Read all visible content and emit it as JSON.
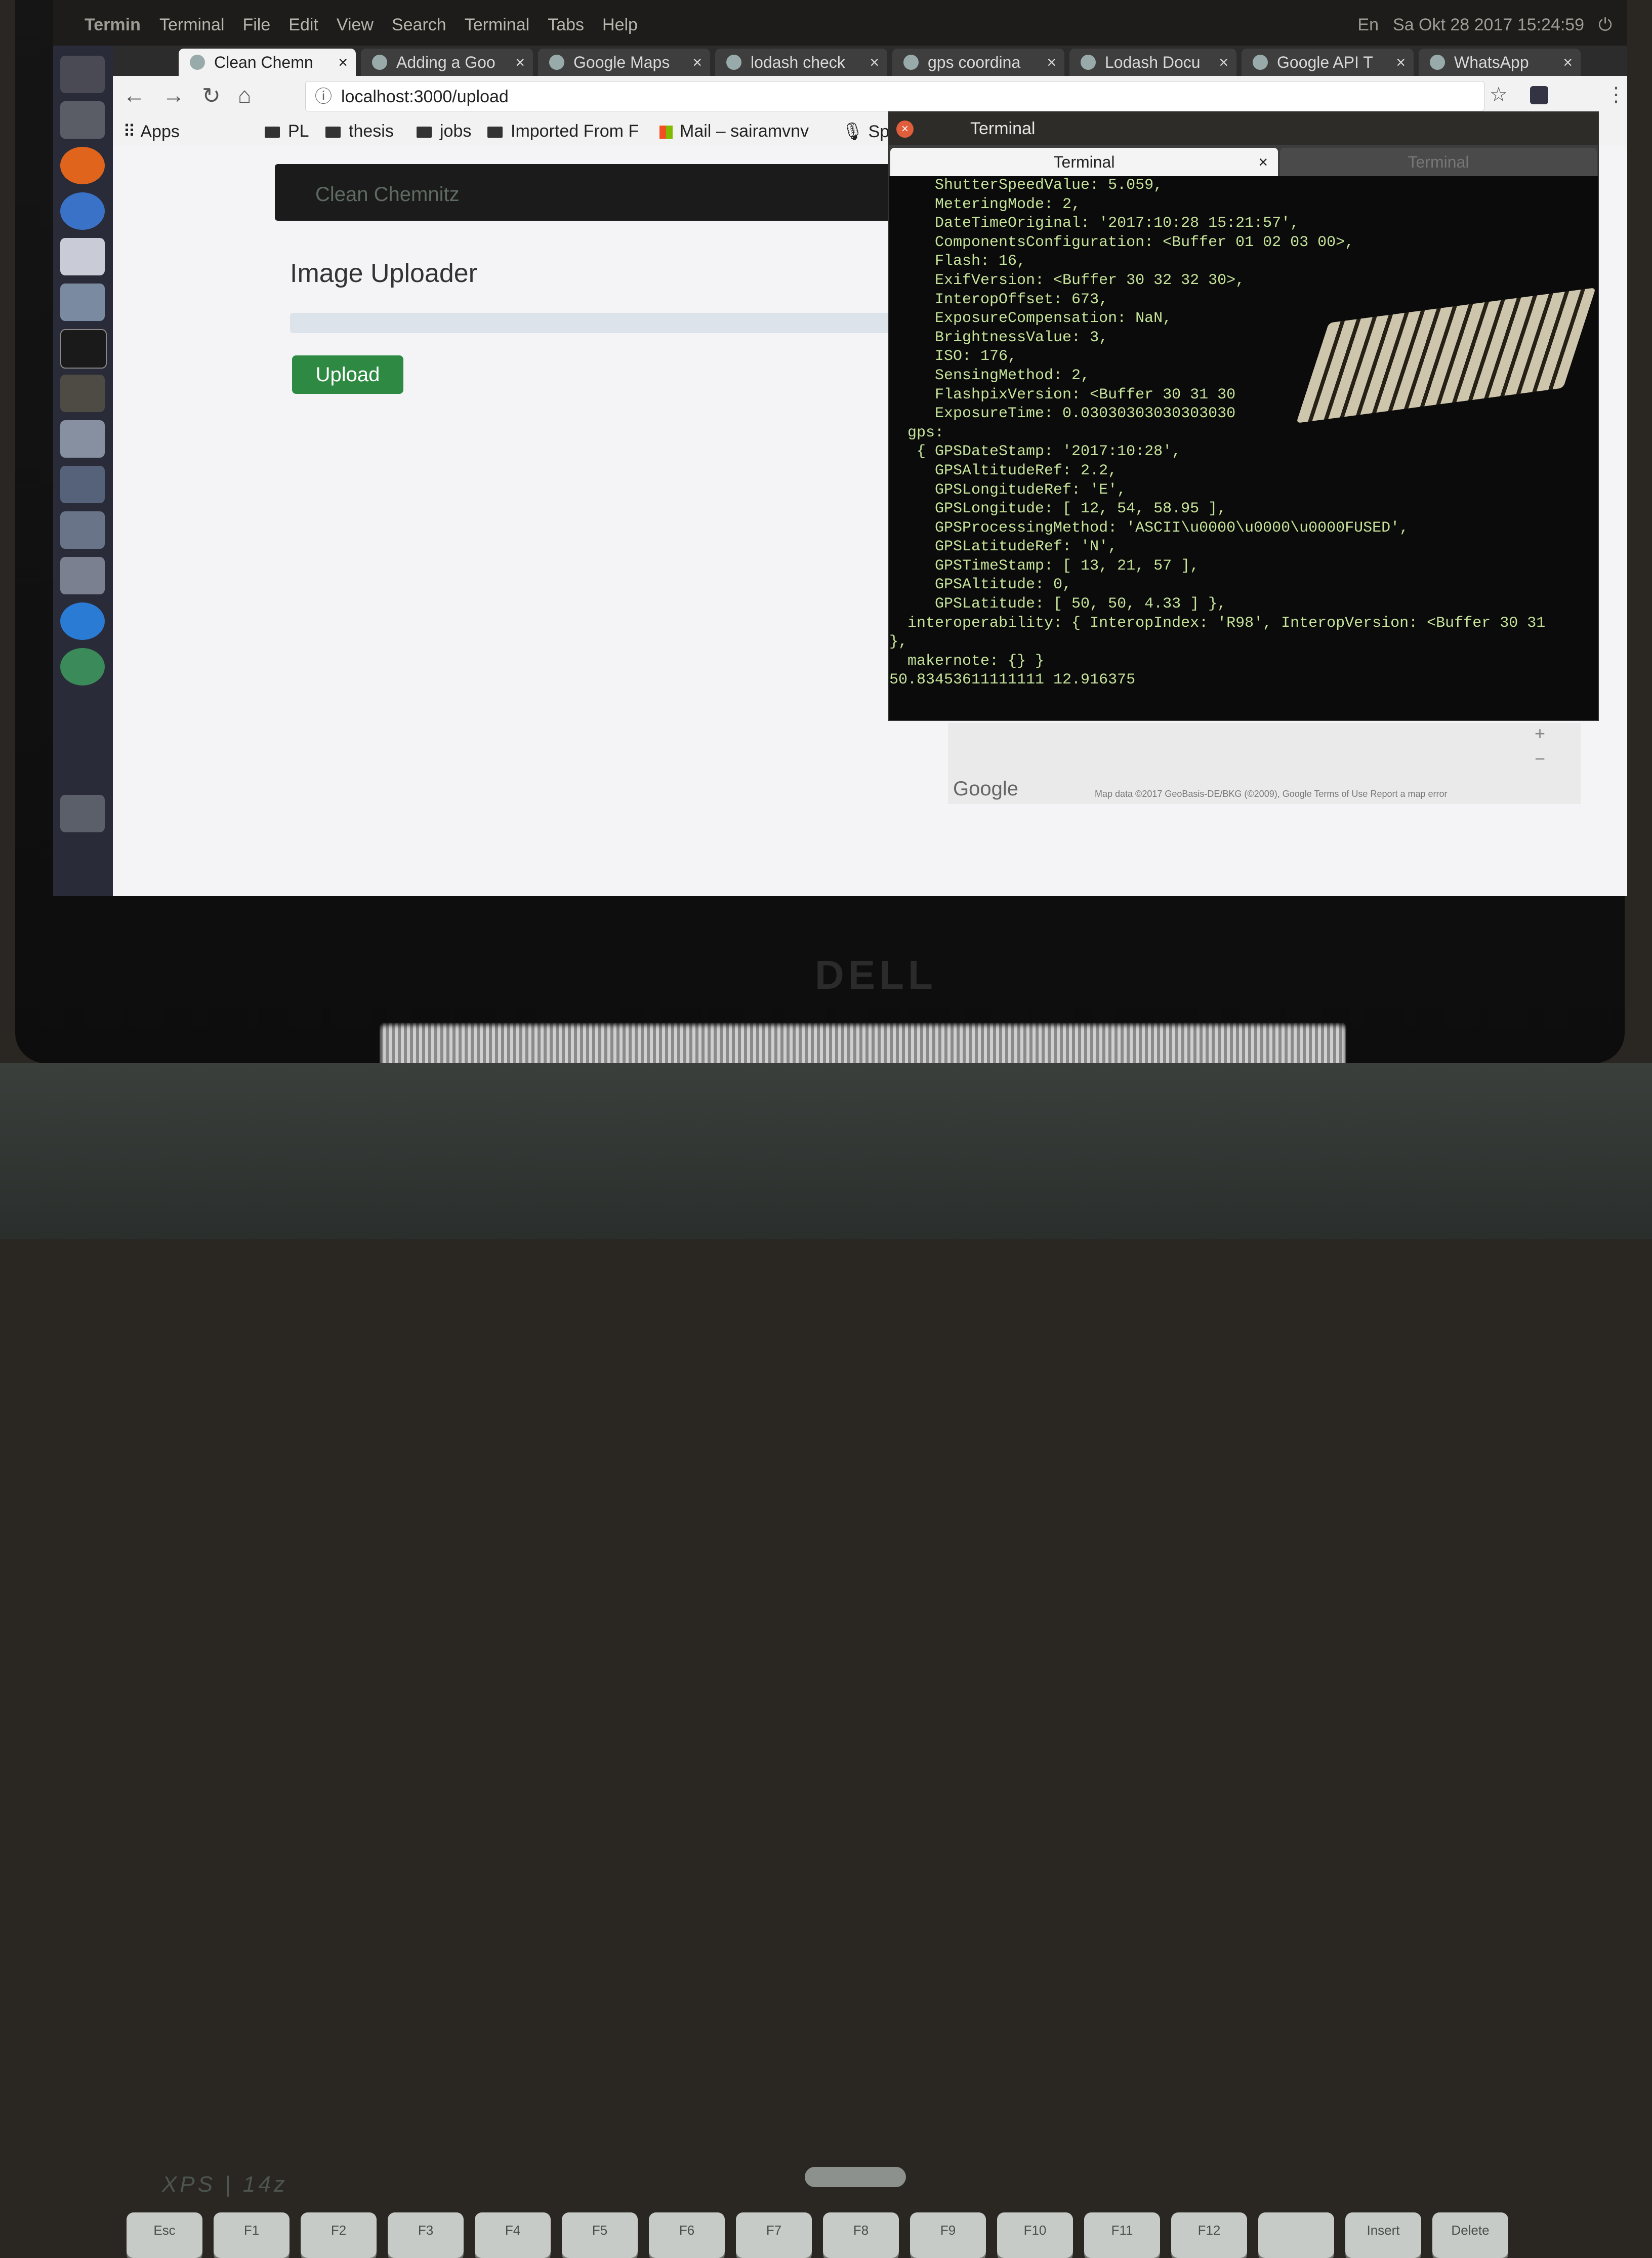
{
  "panel": {
    "app_name": "Termin",
    "menus": [
      "Terminal",
      "File",
      "Edit",
      "View",
      "Search",
      "Terminal",
      "Tabs",
      "Help"
    ],
    "status": [
      "En",
      "Sa Okt 28 2017 15:24:59"
    ]
  },
  "browser": {
    "tabs": [
      {
        "title": "Clean Chemn",
        "active": true
      },
      {
        "title": "Adding a Goo",
        "active": false
      },
      {
        "title": "Google Maps",
        "active": false
      },
      {
        "title": "lodash check",
        "active": false
      },
      {
        "title": "gps coordina",
        "active": false
      },
      {
        "title": "Lodash Docu",
        "active": false
      },
      {
        "title": "Google API T",
        "active": false
      },
      {
        "title": "WhatsApp",
        "active": false
      }
    ],
    "url": "localhost:3000/upload",
    "bookmarks": [
      "Apps",
      "PL",
      "thesis",
      "jobs",
      "Imported From F",
      "Mail – sairamvnv",
      "Speech"
    ]
  },
  "page": {
    "brand": "Clean Chemnitz",
    "title": "Image Uploader",
    "upload_button": "Upload",
    "map": {
      "logo": "Google",
      "attribution": "Map data ©2017 GeoBasis-DE/BKG (©2009), Google   Terms of Use   Report a map error"
    }
  },
  "terminal": {
    "title": "Terminal",
    "tabs": [
      "Terminal",
      "Terminal"
    ],
    "lines": [
      "     ShutterSpeedValue: 5.059,",
      "     MeteringMode: 2,",
      "     DateTimeOriginal: '2017:10:28 15:21:57',",
      "     ComponentsConfiguration: <Buffer 01 02 03 00>,",
      "     Flash: 16,",
      "     ExifVersion: <Buffer 30 32 32 30>,",
      "     InteropOffset: 673,",
      "     ExposureCompensation: NaN,",
      "     BrightnessValue: 3,",
      "     ISO: 176,",
      "     SensingMethod: 2,",
      "     FlashpixVersion: <Buffer 30 31 30",
      "     ExposureTime: 0.03030303030303030",
      "  gps:",
      "   { GPSDateStamp: '2017:10:28',",
      "     GPSAltitudeRef: 2.2,",
      "     GPSLongitudeRef: 'E',",
      "     GPSLongitude: [ 12, 54, 58.95 ],",
      "     GPSProcessingMethod: 'ASCII\\u0000\\u0000\\u0000FUSED',",
      "     GPSLatitudeRef: 'N',",
      "     GPSTimeStamp: [ 13, 21, 57 ],",
      "     GPSAltitude: 0,",
      "     GPSLatitude: [ 50, 50, 4.33 ] },",
      "  interoperability: { InteropIndex: 'R98', InteropVersion: <Buffer 30 31",
      "},",
      "  makernote: {} }",
      "50.83453611111111 12.916375"
    ]
  },
  "laptop": {
    "brand": "DELL",
    "model": "XPS | 14z",
    "keys": [
      "Esc",
      "F1",
      "F2",
      "F3",
      "F4",
      "F5",
      "F6",
      "F7",
      "F8",
      "F9",
      "F10",
      "F11",
      "F12",
      "",
      "Insert",
      "Delete"
    ]
  }
}
